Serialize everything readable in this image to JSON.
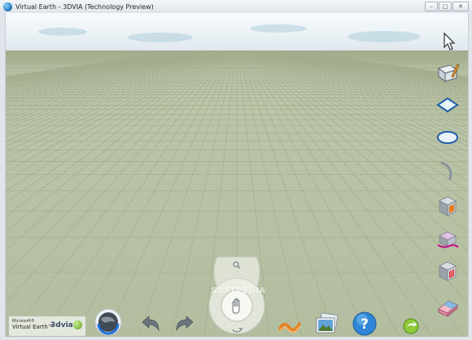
{
  "window": {
    "title": "Virtual Earth - 3DVIA (Technology Preview)",
    "controls": {
      "minimize": "–",
      "maximize": "□",
      "close": "✕"
    }
  },
  "branding": {
    "microsoft": "Microsoft®",
    "virtual_earth": "Virtual Earth™",
    "dvia": "3dvia"
  },
  "watermark": "SOFTPEDIA",
  "tools": {
    "right": [
      "arrow-cursor-icon",
      "pencil-draw-icon",
      "rectangle-icon",
      "ellipse-icon",
      "arc-icon",
      "push-pull-icon",
      "paint-bucket-icon",
      "material-icon",
      "eraser-icon"
    ],
    "bottom": [
      "globe-icon",
      "undo-icon",
      "redo-icon",
      "navigation-wheel",
      "animation-icon",
      "photo-icon",
      "help-icon",
      "publish-icon"
    ]
  },
  "colors": {
    "ground": "#b7c1a3",
    "grid_line": "#a3ad8e",
    "sky": "#eef3f6",
    "help_blue": "#2f86d6",
    "accent_orange": "#e8801f"
  }
}
